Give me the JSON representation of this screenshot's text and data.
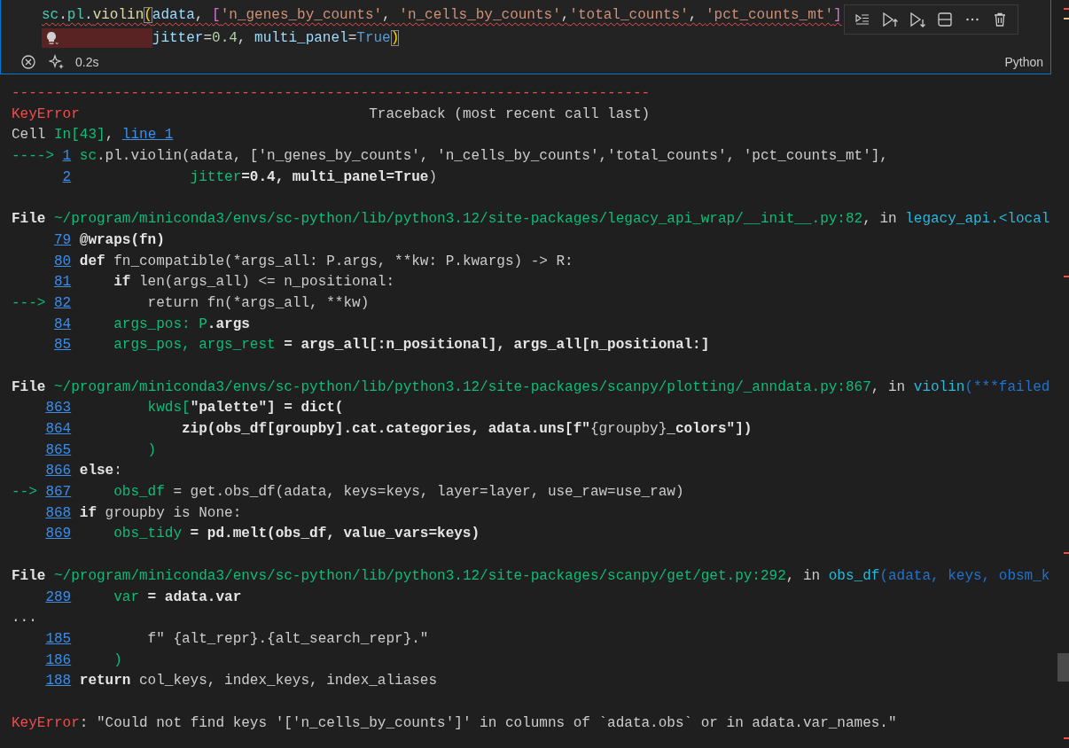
{
  "cell": {
    "code": [
      {
        "squiggle": true,
        "hint": false,
        "tokens": [
          {
            "text": "sc",
            "kind": "module"
          },
          {
            "text": ".",
            "kind": "punct"
          },
          {
            "text": "pl",
            "kind": "module"
          },
          {
            "text": ".",
            "kind": "punct"
          },
          {
            "text": "violin",
            "kind": "fn"
          },
          {
            "text": "(",
            "kind": "match"
          },
          {
            "text": "adata",
            "kind": "var"
          },
          {
            "text": ", ",
            "kind": "punct"
          },
          {
            "text": "[",
            "kind": "list"
          },
          {
            "text": "'n_genes_by_counts'",
            "kind": "str"
          },
          {
            "text": ", ",
            "kind": "punct"
          },
          {
            "text": "'n_cells_by_counts'",
            "kind": "str"
          },
          {
            "text": ",",
            "kind": "punct"
          },
          {
            "text": "'total_counts'",
            "kind": "str"
          },
          {
            "text": ", ",
            "kind": "punct"
          },
          {
            "text": "'pct_counts_mt'",
            "kind": "str"
          },
          {
            "text": "]",
            "kind": "list"
          }
        ]
      },
      {
        "squiggle": false,
        "hint": true,
        "tokens": [
          {
            "text": "jitter",
            "kind": "var"
          },
          {
            "text": "=",
            "kind": "punct"
          },
          {
            "text": "0.4",
            "kind": "num"
          },
          {
            "text": ", ",
            "kind": "punct"
          },
          {
            "text": "multi_panel",
            "kind": "var"
          },
          {
            "text": "=",
            "kind": "punct"
          },
          {
            "text": "True",
            "kind": "const"
          },
          {
            "text": ")",
            "kind": "match"
          }
        ]
      }
    ],
    "toolbar": [
      {
        "kind": "run-by-line"
      },
      {
        "kind": "run-above"
      },
      {
        "kind": "run-below"
      },
      {
        "kind": "split"
      },
      {
        "kind": "more"
      },
      {
        "kind": "delete"
      }
    ],
    "status": {
      "duration": "0.2s",
      "language": "Python"
    }
  },
  "output": {
    "rule": "---------------------------------------------------------------------------",
    "header": {
      "error": "KeyError",
      "title": "Traceback (most recent call last)"
    },
    "frames": [
      {
        "location": [
          {
            "text": "Cell ",
            "kind": "text"
          },
          {
            "text": "In[43]",
            "kind": "name"
          },
          {
            "text": ", ",
            "kind": "text"
          },
          {
            "text": "line 1",
            "kind": "link"
          }
        ],
        "lines": [
          {
            "arrow": "---->",
            "number": "1",
            "tokens": [
              {
                "text": "sc",
                "kind": "name"
              },
              {
                "text": ".pl.violin(adata, ['n_genes_by_counts', 'n_cells_by_counts','total_counts', 'pct_counts_mt'],",
                "kind": "text"
              }
            ]
          },
          {
            "number": "2",
            "tokens": [
              {
                "text": "             jitter",
                "kind": "name"
              },
              {
                "text": "=0.4, multi_panel=True",
                "kind": "strong"
              },
              {
                "text": ")",
                "kind": "text"
              }
            ]
          }
        ]
      },
      {
        "location": [
          {
            "text": "File ",
            "kind": "strong"
          },
          {
            "text": "~/program/miniconda3/envs/sc-python/lib/python3.12/site-packages/legacy_api_wrap/__init__.py:82",
            "kind": "path"
          },
          {
            "text": ", in ",
            "kind": "text"
          },
          {
            "text": "legacy_api.<local",
            "kind": "func"
          }
        ],
        "lines": [
          {
            "number": "79",
            "tokens": [
              {
                "text": "@wraps(fn)",
                "kind": "strong"
              }
            ]
          },
          {
            "number": "80",
            "tokens": [
              {
                "text": "def",
                "kind": "strong"
              },
              {
                "text": " fn_compatible(*args_all: P.args, **kw: P.kwargs) -> R:",
                "kind": "text"
              }
            ]
          },
          {
            "number": "81",
            "tokens": [
              {
                "text": "    if",
                "kind": "strong"
              },
              {
                "text": " len(args_all) <= n_positional:",
                "kind": "text"
              }
            ]
          },
          {
            "arrow": "--->",
            "number": "82",
            "tokens": [
              {
                "text": "        return fn(*args_all, **kw)",
                "kind": "text"
              }
            ]
          },
          {
            "number": "84",
            "tokens": [
              {
                "text": "    args_pos: P",
                "kind": "name"
              },
              {
                "text": ".args",
                "kind": "strong"
              }
            ]
          },
          {
            "number": "85",
            "tokens": [
              {
                "text": "    args_pos, args_rest",
                "kind": "name"
              },
              {
                "text": " = args_all[:n_positional], args_all[n_positional:]",
                "kind": "strong"
              }
            ]
          }
        ]
      },
      {
        "location": [
          {
            "text": "File ",
            "kind": "strong"
          },
          {
            "text": "~/program/miniconda3/envs/sc-python/lib/python3.12/site-packages/scanpy/plotting/_anndata.py:867",
            "kind": "path"
          },
          {
            "text": ", in ",
            "kind": "text"
          },
          {
            "text": "violin",
            "kind": "func"
          },
          {
            "text": "(***failed",
            "kind": "call"
          }
        ],
        "lines": [
          {
            "number": "863",
            "tokens": [
              {
                "text": "        kwds[",
                "kind": "name"
              },
              {
                "text": "\"palette\"] = dict(",
                "kind": "strong"
              }
            ]
          },
          {
            "number": "864",
            "tokens": [
              {
                "text": "            zip(obs_df[groupby].cat.categories, adata.uns[f\"",
                "kind": "strong"
              },
              {
                "text": "{groupby}",
                "kind": "text"
              },
              {
                "text": "_colors\"])",
                "kind": "strong"
              }
            ]
          },
          {
            "number": "865",
            "tokens": [
              {
                "text": "        )",
                "kind": "name"
              }
            ]
          },
          {
            "number": "866",
            "tokens": [
              {
                "text": "else",
                "kind": "strong"
              },
              {
                "text": ":",
                "kind": "text"
              }
            ]
          },
          {
            "arrow": "-->",
            "number": "867",
            "tokens": [
              {
                "text": "    obs_df",
                "kind": "name"
              },
              {
                "text": " = get.obs_df(adata, keys=keys, layer=layer, use_raw=use_raw)",
                "kind": "text"
              }
            ]
          },
          {
            "number": "868",
            "tokens": [
              {
                "text": "if",
                "kind": "strong"
              },
              {
                "text": " groupby is None:",
                "kind": "text"
              }
            ]
          },
          {
            "number": "869",
            "tokens": [
              {
                "text": "    obs_tidy",
                "kind": "name"
              },
              {
                "text": " = pd.melt(obs_df, value_vars=keys)",
                "kind": "strong"
              }
            ]
          }
        ]
      },
      {
        "location": [
          {
            "text": "File ",
            "kind": "strong"
          },
          {
            "text": "~/program/miniconda3/envs/sc-python/lib/python3.12/site-packages/scanpy/get/get.py:292",
            "kind": "path"
          },
          {
            "text": ", in ",
            "kind": "text"
          },
          {
            "text": "obs_df",
            "kind": "func"
          },
          {
            "text": "(adata, keys, obsm_k",
            "kind": "call"
          }
        ],
        "lines": [
          {
            "number": "289",
            "tokens": [
              {
                "text": "    var",
                "kind": "name"
              },
              {
                "text": " = adata.var",
                "kind": "strong"
              }
            ]
          },
          {
            "tokens": [
              {
                "text": "...",
                "kind": "text"
              }
            ]
          },
          {
            "number": "185",
            "tokens": [
              {
                "text": "        f\" {alt_repr}.{alt_search_repr}.\"",
                "kind": "text"
              }
            ]
          },
          {
            "number": "186",
            "tokens": [
              {
                "text": "    )",
                "kind": "name"
              }
            ]
          },
          {
            "number": "188",
            "tokens": [
              {
                "text": "return",
                "kind": "strong"
              },
              {
                "text": " col_keys, index_keys, index_aliases",
                "kind": "text"
              }
            ]
          }
        ]
      }
    ],
    "message": [
      {
        "text": "KeyError",
        "kind": "error"
      },
      {
        "text": ": \"Could not find keys '['n_cells_by_counts']' in columns of `adata.obs` or in adata.var_names.\"",
        "kind": "text"
      }
    ]
  }
}
